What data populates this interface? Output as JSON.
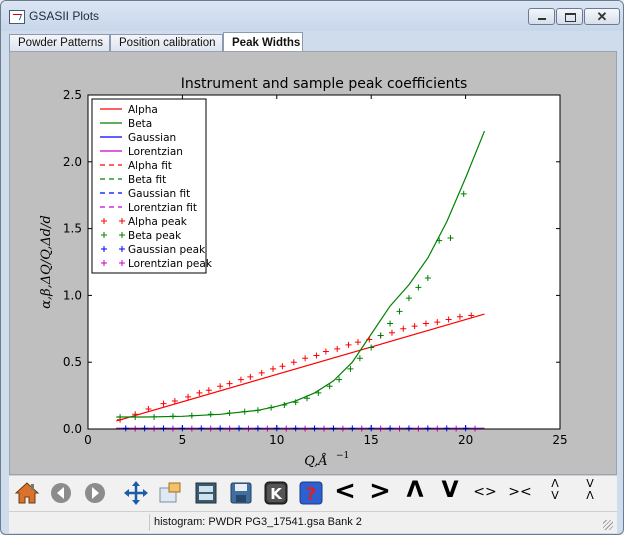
{
  "window": {
    "title": "GSASII Plots"
  },
  "tabs": [
    {
      "label": "Powder Patterns",
      "active": false
    },
    {
      "label": "Position calibration",
      "active": false
    },
    {
      "label": "Peak Widths",
      "active": true
    }
  ],
  "toolbar": {
    "icons": [
      "home-icon",
      "back-icon",
      "forward-icon",
      "pan-icon",
      "zoom-icon",
      "subplots-icon",
      "save-icon",
      "k-key-icon",
      "help-icon"
    ],
    "arrows": [
      "<",
      ">",
      "Λ",
      "V",
      "<>",
      "><"
    ],
    "vert_labels": [
      [
        "Λ",
        "V"
      ],
      [
        "V",
        "Λ"
      ]
    ]
  },
  "status": {
    "text": "histogram: PWDR PG3_17541.gsa Bank 2"
  },
  "colors": {
    "alpha": "#ff0000",
    "beta": "#008000",
    "gaussian": "#0000ff",
    "lorentzian": "#cc00cc",
    "plot_bg": "#bfbfbf"
  },
  "chart_data": {
    "type": "line",
    "title": "Instrument and sample peak coefficients",
    "xlabel": "Q,Å",
    "xlabel_sup": "−1",
    "ylabel": "α,β,ΔQ/Q,Δd/d",
    "xlim": [
      0,
      25
    ],
    "ylim": [
      0,
      2.5
    ],
    "xticks": [
      0,
      5,
      10,
      15,
      20,
      25
    ],
    "yticks": [
      0.0,
      0.5,
      1.0,
      1.5,
      2.0,
      2.5
    ],
    "xtick_labels": [
      "0",
      "5",
      "10",
      "15",
      "20",
      "25"
    ],
    "ytick_labels": [
      "0.0",
      "0.5",
      "1.0",
      "1.5",
      "2.0",
      "2.5"
    ],
    "grid": false,
    "legend_position": "upper-left",
    "legend": [
      {
        "label": "Alpha",
        "color": "#ff0000",
        "style": "solid"
      },
      {
        "label": "Beta",
        "color": "#008000",
        "style": "solid"
      },
      {
        "label": "Gaussian",
        "color": "#0000ff",
        "style": "solid"
      },
      {
        "label": "Lorentzian",
        "color": "#cc00cc",
        "style": "solid"
      },
      {
        "label": "Alpha fit",
        "color": "#ff0000",
        "style": "dashed"
      },
      {
        "label": "Beta fit",
        "color": "#008000",
        "style": "dashed"
      },
      {
        "label": "Gaussian fit",
        "color": "#0000ff",
        "style": "dashed"
      },
      {
        "label": "Lorentzian fit",
        "color": "#cc00cc",
        "style": "dashed"
      },
      {
        "label": "Alpha peak",
        "color": "#ff0000",
        "style": "plus"
      },
      {
        "label": "Beta peak",
        "color": "#008000",
        "style": "plus"
      },
      {
        "label": "Gaussian peak",
        "color": "#0000ff",
        "style": "plus"
      },
      {
        "label": "Lorentzian peak",
        "color": "#cc00cc",
        "style": "plus"
      }
    ],
    "series": [
      {
        "name": "Alpha",
        "color": "#ff0000",
        "style": "solid",
        "x": [
          1.5,
          21
        ],
        "y": [
          0.06,
          0.86
        ]
      },
      {
        "name": "Beta",
        "color": "#008000",
        "style": "solid",
        "x": [
          1.5,
          3,
          5,
          7,
          9,
          10,
          11,
          12,
          13,
          14,
          15,
          16,
          17,
          18,
          19,
          20,
          21
        ],
        "y": [
          0.09,
          0.09,
          0.095,
          0.11,
          0.14,
          0.17,
          0.21,
          0.27,
          0.36,
          0.5,
          0.71,
          0.92,
          1.08,
          1.28,
          1.55,
          1.88,
          2.23
        ]
      },
      {
        "name": "Gaussian",
        "color": "#0000ff",
        "style": "solid",
        "x": [
          1.5,
          21
        ],
        "y": [
          0.005,
          0.005
        ]
      },
      {
        "name": "Lorentzian",
        "color": "#cc00cc",
        "style": "solid",
        "x": [
          1.5,
          21
        ],
        "y": [
          0.003,
          0.003
        ]
      },
      {
        "name": "Alpha peak",
        "color": "#ff0000",
        "style": "plus",
        "x": [
          1.7,
          2.5,
          3.2,
          4.0,
          4.6,
          5.3,
          5.9,
          6.4,
          7.0,
          7.5,
          8.1,
          8.6,
          9.2,
          9.8,
          10.3,
          10.9,
          11.5,
          12.1,
          12.6,
          13.2,
          13.8,
          14.3,
          14.9,
          15.5,
          16.1,
          16.7,
          17.3,
          17.9,
          18.5,
          19.1,
          19.7,
          20.3
        ],
        "y": [
          0.07,
          0.11,
          0.15,
          0.19,
          0.21,
          0.24,
          0.27,
          0.29,
          0.32,
          0.34,
          0.37,
          0.39,
          0.42,
          0.45,
          0.47,
          0.5,
          0.53,
          0.55,
          0.58,
          0.6,
          0.63,
          0.65,
          0.67,
          0.7,
          0.72,
          0.75,
          0.77,
          0.79,
          0.8,
          0.82,
          0.84,
          0.85
        ]
      },
      {
        "name": "Beta peak",
        "color": "#008000",
        "style": "plus",
        "x": [
          1.7,
          2.5,
          3.5,
          4.5,
          5.5,
          6.5,
          7.5,
          8.3,
          9.0,
          9.7,
          10.4,
          11.0,
          11.6,
          12.2,
          12.8,
          13.3,
          13.9,
          14.4,
          15.0,
          15.5,
          16.0,
          16.5,
          17.0,
          17.5,
          18.0,
          18.6,
          19.2,
          19.9
        ],
        "y": [
          0.09,
          0.09,
          0.09,
          0.095,
          0.1,
          0.11,
          0.12,
          0.13,
          0.14,
          0.16,
          0.18,
          0.2,
          0.23,
          0.27,
          0.32,
          0.37,
          0.45,
          0.53,
          0.61,
          0.7,
          0.79,
          0.88,
          0.98,
          1.06,
          1.13,
          1.41,
          1.43,
          1.76
        ]
      },
      {
        "name": "Gaussian peak",
        "color": "#0000ff",
        "style": "plus",
        "x": [
          2.0,
          3.0,
          4.0,
          5.0,
          6.0,
          7.0,
          8.0,
          9.0,
          10.0,
          11.0,
          12.0,
          13.0,
          14.0,
          15.0,
          16.0,
          17.0,
          18.0,
          19.0,
          20.0
        ],
        "y": [
          0.005,
          0.005,
          0.005,
          0.005,
          0.005,
          0.005,
          0.005,
          0.005,
          0.005,
          0.005,
          0.005,
          0.005,
          0.005,
          0.005,
          0.005,
          0.005,
          0.005,
          0.005,
          0.005
        ]
      },
      {
        "name": "Lorentzian peak",
        "color": "#cc00cc",
        "style": "plus",
        "x": [
          2.5,
          3.5,
          4.5,
          5.5,
          6.5,
          7.5,
          8.5,
          9.5,
          10.5,
          11.5,
          12.5,
          13.5,
          14.5,
          15.5,
          16.5,
          17.5,
          18.5,
          19.5,
          20.5
        ],
        "y": [
          0.003,
          0.003,
          0.003,
          0.003,
          0.003,
          0.003,
          0.003,
          0.003,
          0.003,
          0.003,
          0.003,
          0.003,
          0.003,
          0.003,
          0.003,
          0.003,
          0.003,
          0.003,
          0.003
        ]
      }
    ]
  }
}
